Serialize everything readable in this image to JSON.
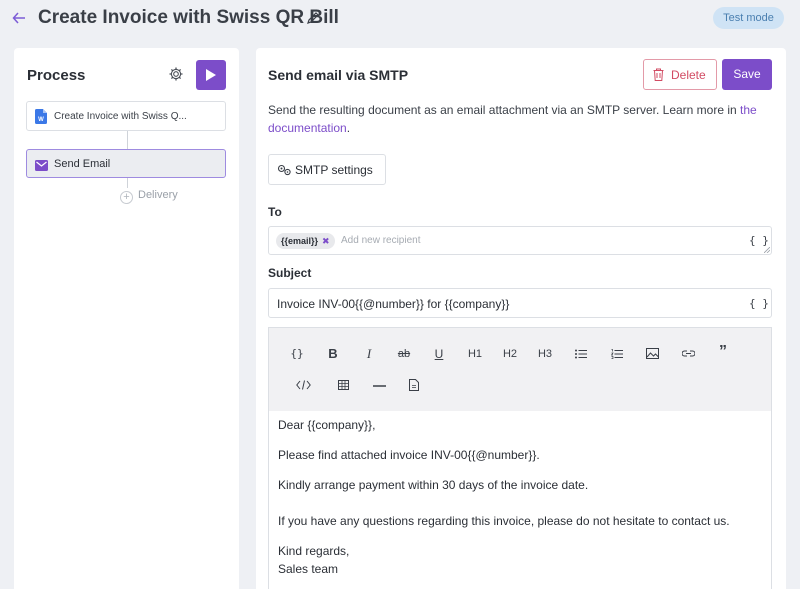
{
  "header": {
    "back_icon": "arrow-left-icon",
    "title": "Create Invoice with Swiss QR Bill",
    "edit_icon": "pencil-icon",
    "mode_badge": "Test mode"
  },
  "process": {
    "title": "Process",
    "settings_icon": "gear-icon",
    "run_icon": "play-icon",
    "steps": [
      {
        "label": "Create Invoice with Swiss Q...",
        "icon": "document-icon"
      },
      {
        "label": "Send Email",
        "icon": "mail-icon"
      }
    ],
    "add_label": "Delivery"
  },
  "panel": {
    "title": "Send email via SMTP",
    "delete_label": "Delete",
    "save_label": "Save",
    "description": "Send the resulting document as an email attachment via an SMTP server. Learn more in",
    "description_link": "the documentation",
    "description_end": ".",
    "smtp_button": "SMTP settings",
    "to_label": "To",
    "to_chip": "{{email}}",
    "to_placeholder": "Add new recipient",
    "subject_label": "Subject",
    "subject_value": "Invoice INV-00{{@number}} for {{company}}",
    "variable_icon": "{ }"
  },
  "toolbar": {
    "items": [
      "{}",
      "B",
      "I",
      "ab",
      "U",
      "H1",
      "H2",
      "H3",
      "bullet-list-icon",
      "numbered-list-icon",
      "image-icon",
      "link-icon",
      "quote-icon",
      "code-icon",
      "table-icon",
      "horizontal-rule-icon",
      "file-icon"
    ]
  },
  "body": {
    "line1": "Dear {{company}},",
    "line2": "Please find attached invoice INV-00{{@number}}.",
    "line3": "Kindly arrange payment within 30 days of the invoice date.",
    "line4": "If you have any questions regarding this invoice, please do not hesitate to contact us.",
    "line5": "Kind regards,",
    "line6": "Sales team"
  },
  "colors": {
    "accent": "#7c4dc9",
    "danger": "#d24b63",
    "badge_bg": "#cfe3f5"
  }
}
